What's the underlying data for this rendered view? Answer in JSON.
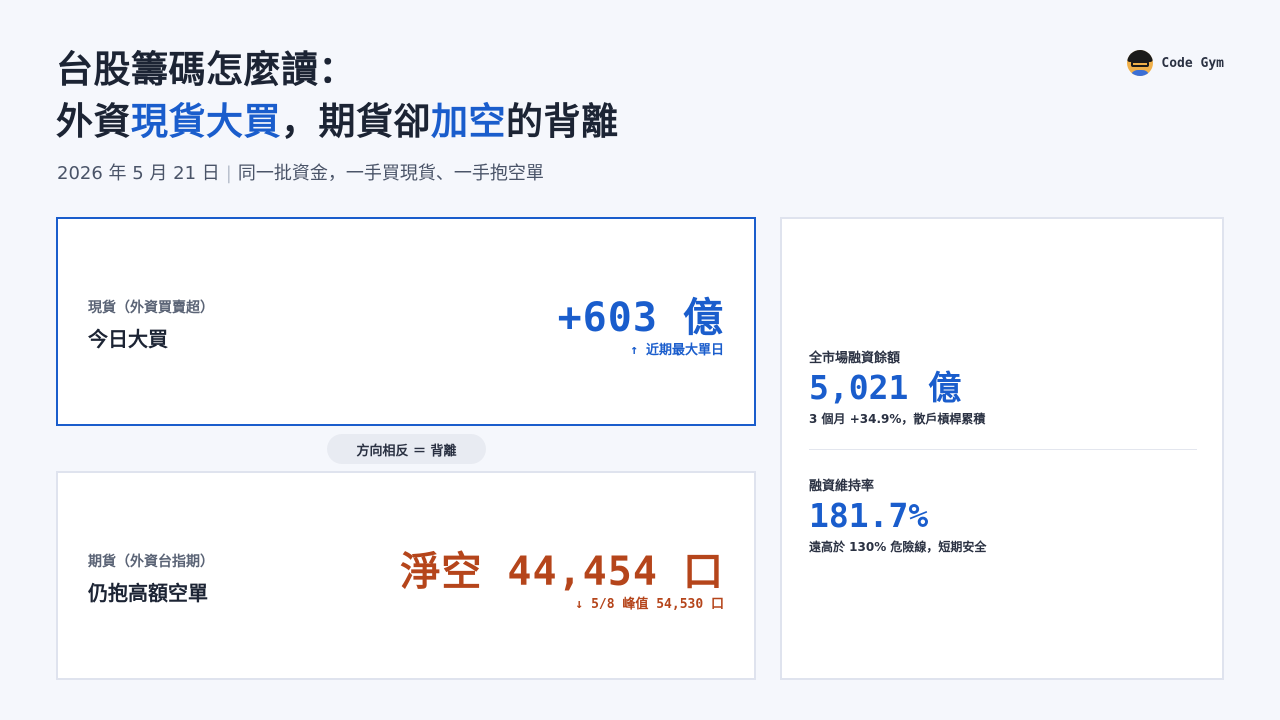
{
  "title": {
    "line1": "台股籌碼怎麼讀：",
    "line2_a": "外資",
    "line2_hl1": "現貨大買",
    "line2_b": "，期貨卻",
    "line2_hl2": "加空",
    "line2_c": "的背離"
  },
  "subtitle": {
    "date": "2026 年 5 月 21 日",
    "separator": "|",
    "text": "同一批資金，一手買現貨、一手抱空單"
  },
  "brand": {
    "name": "Code Gym",
    "icon": "avatar-icon"
  },
  "spot_card": {
    "label": "現貨（外資買賣超）",
    "name": "今日大買",
    "value": "+603 億",
    "note": "↑ 近期最大單日"
  },
  "pill": {
    "text": "方向相反 ＝ 背離"
  },
  "futures_card": {
    "label": "期貨（外資台指期）",
    "name": "仍抱高額空單",
    "value": "淨空 44,454 口",
    "note": "↓ 5/8 峰值 54,530 口"
  },
  "side_card": {
    "margin": {
      "label": "全市場融資餘額",
      "value": "5,021 億",
      "note": "3 個月 +34.9%，散戶槓桿累積"
    },
    "maintenance": {
      "label": "融資維持率",
      "value": "181.7%",
      "note": "遠高於 130% 危險線，短期安全"
    }
  },
  "colors": {
    "accent_blue": "#1a5dcc",
    "accent_orange": "#b5451b",
    "background": "#f5f7fc"
  }
}
